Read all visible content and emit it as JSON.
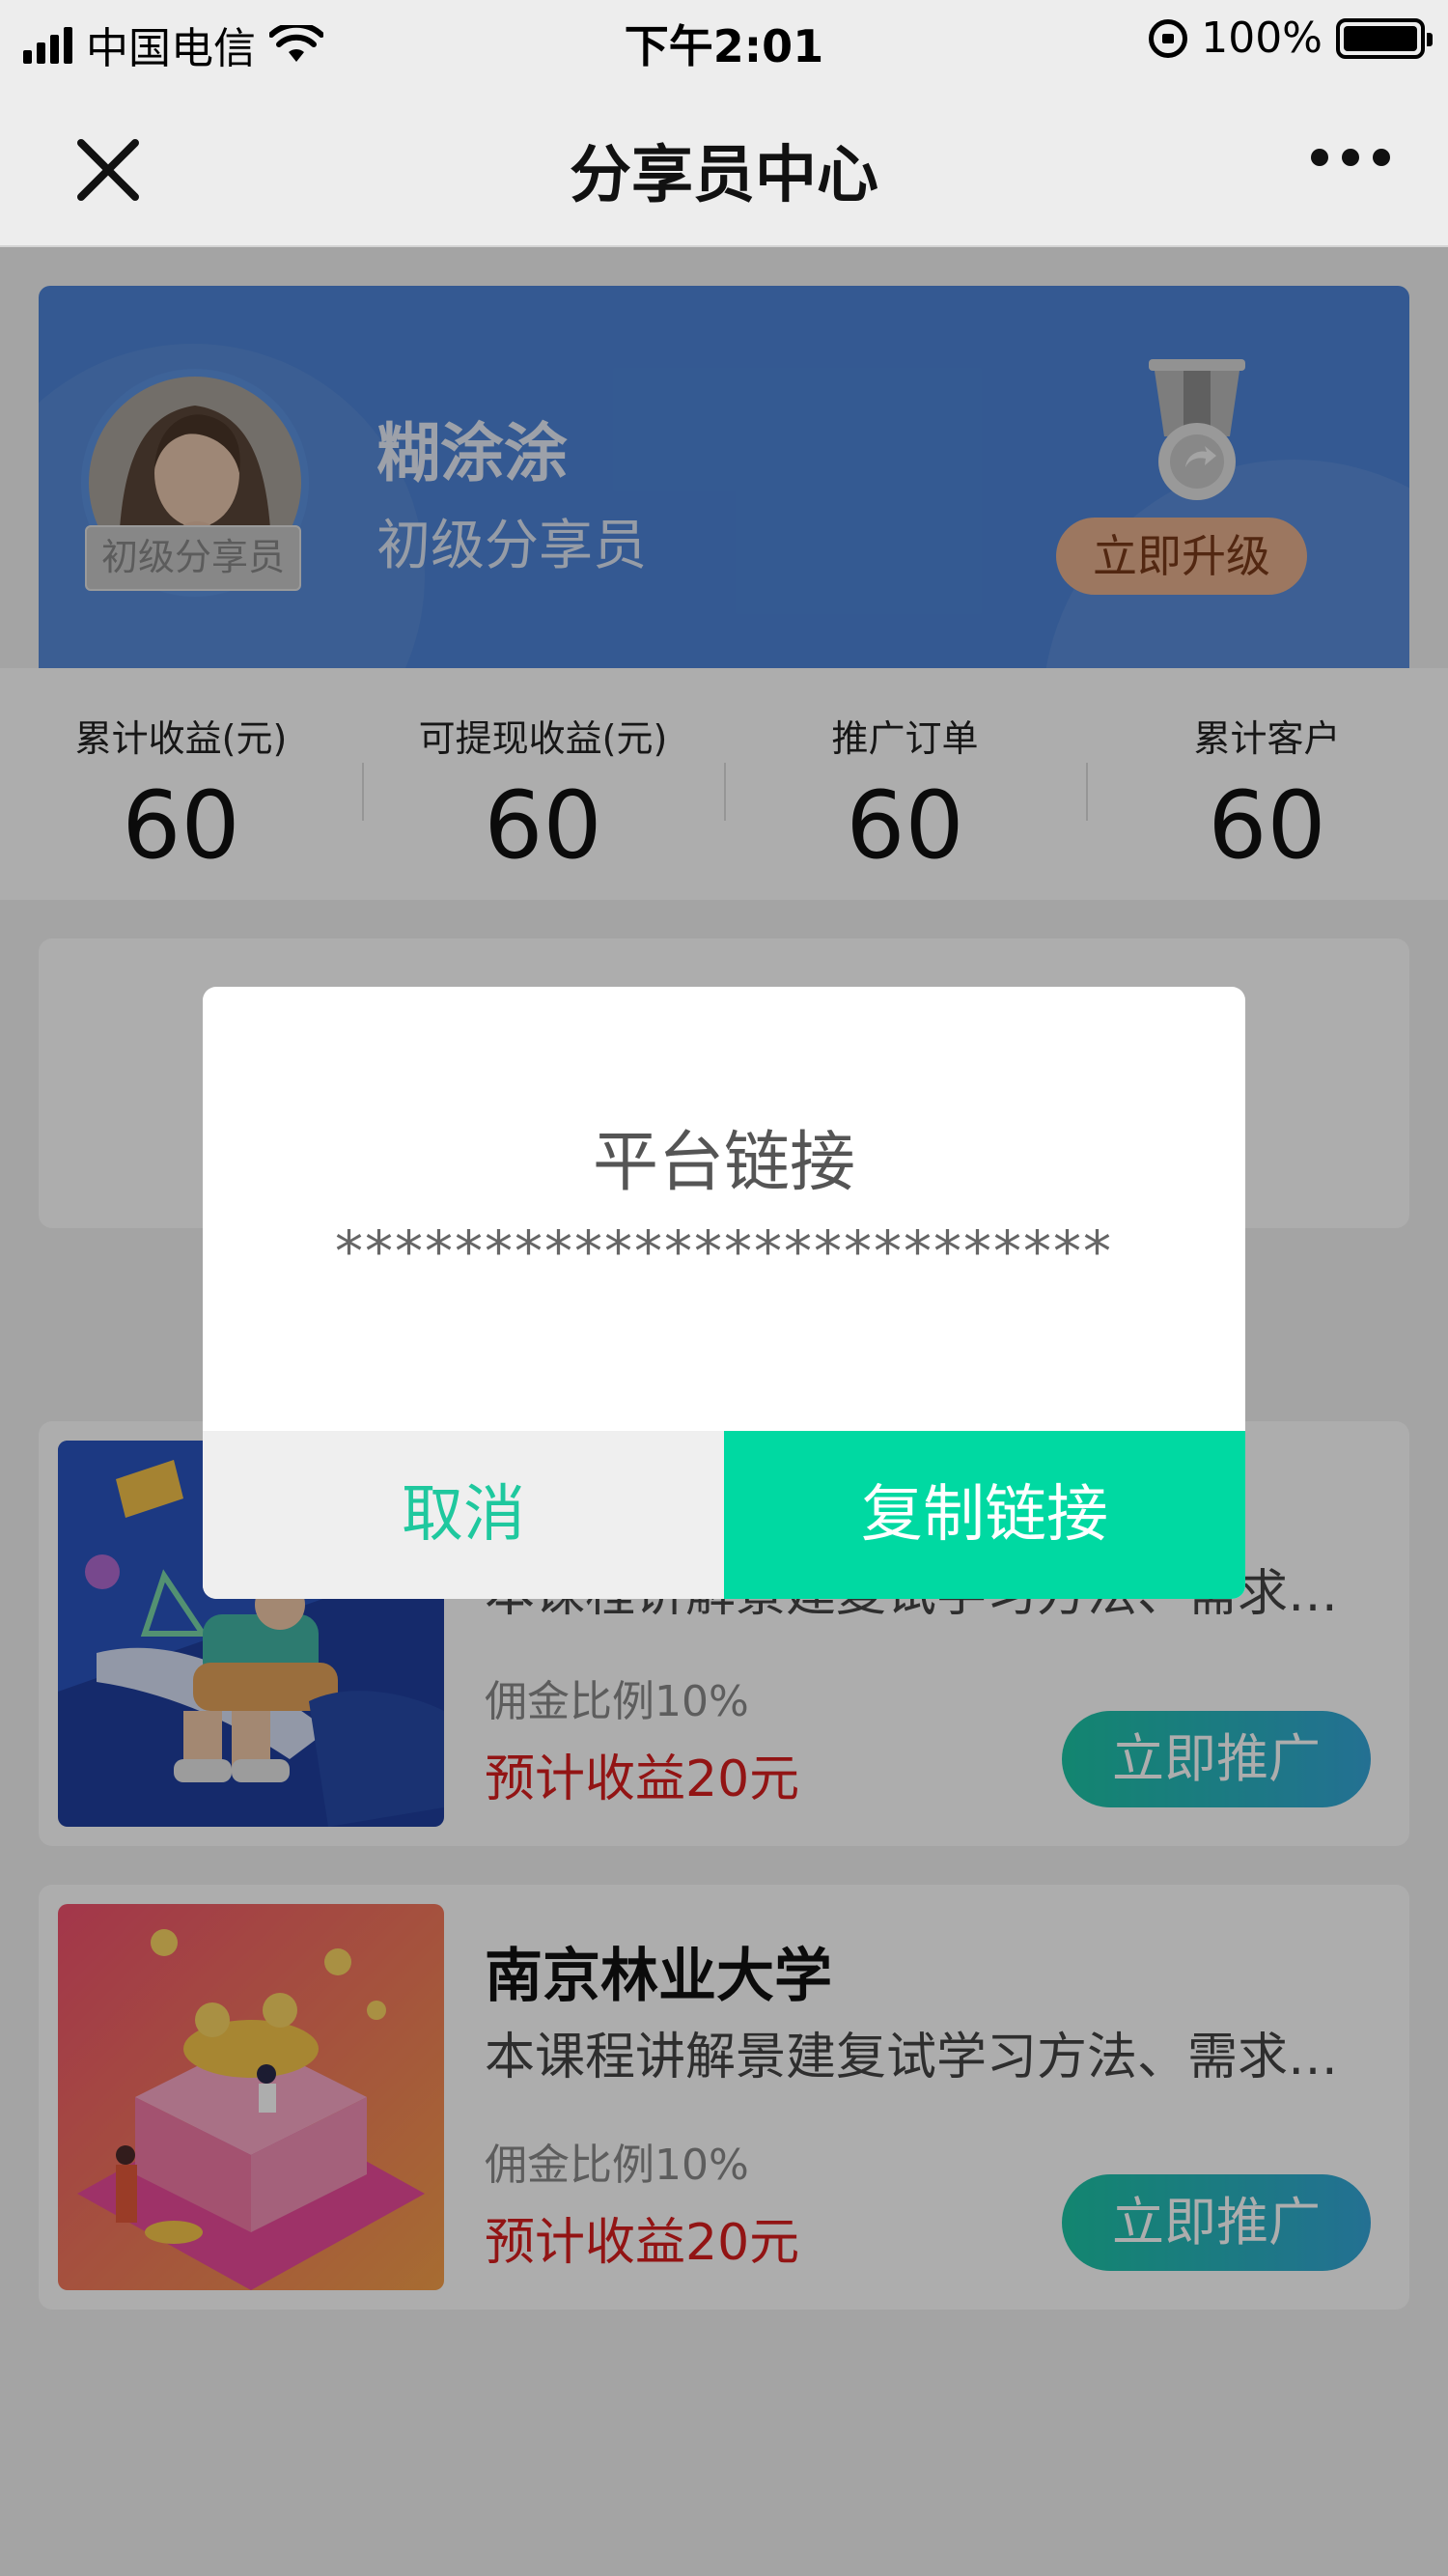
{
  "status_bar": {
    "carrier": "中国电信",
    "time": "下午2:01",
    "battery": "100%"
  },
  "nav": {
    "title": "分享员中心",
    "close_icon": "close-icon",
    "more_icon": "more-icon"
  },
  "profile": {
    "name": "糊涂涂",
    "level": "初级分享员",
    "badge": "初级分享员",
    "upgrade_label": "立即升级"
  },
  "stats": [
    {
      "label": "累计收益(元)",
      "value": "60"
    },
    {
      "label": "可提现收益(元)",
      "value": "60"
    },
    {
      "label": "推广订单",
      "value": "60"
    },
    {
      "label": "累计客户",
      "value": "60"
    }
  ],
  "courses": [
    {
      "title": "",
      "desc": "本课程讲解景建复试学习方法、需求分析",
      "rate": "佣金比例10%",
      "earn": "预计收益20元",
      "button": "立即推广"
    },
    {
      "title": "南京林业大学",
      "desc": "本课程讲解景建复试学习方法、需求分析",
      "rate": "佣金比例10%",
      "earn": "预计收益20元",
      "button": "立即推广"
    }
  ],
  "modal": {
    "title": "平台链接",
    "content": "**************************",
    "cancel": "取消",
    "confirm": "复制链接"
  },
  "colors": {
    "profile_bg": "#4d84d7",
    "accent_green": "#00d9a2",
    "earn_red": "#d81e1e",
    "upgrade_bg": "#e6b08e"
  }
}
